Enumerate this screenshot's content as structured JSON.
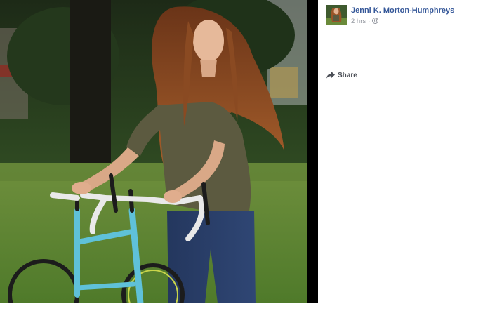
{
  "photo": {
    "alt": "Woman with long curly hair standing behind a turquoise road bike in a park"
  },
  "post": {
    "author_name": "Jenni K. Morton-Humphreys",
    "timestamp": "2 hrs",
    "separator": "·",
    "privacy_icon": "globe-icon"
  },
  "actions": {
    "share_label": "Share",
    "share_icon": "share-arrow-icon"
  },
  "colors": {
    "author_link": "#365899",
    "meta_text": "#90949c",
    "action_text": "#4b4f56",
    "divider": "#dddfe2",
    "stage_background": "#000000"
  }
}
